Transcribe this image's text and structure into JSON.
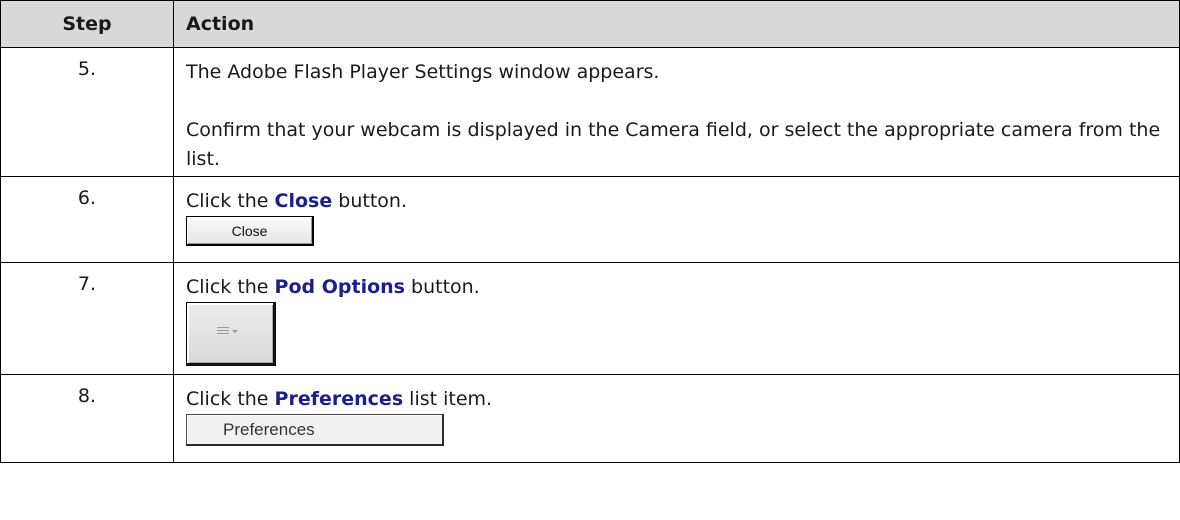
{
  "table": {
    "headers": {
      "step": "Step",
      "action": "Action"
    },
    "rows": [
      {
        "step": "5.",
        "line1": "The Adobe Flash Player Settings window appears.",
        "line2": "Confirm that your webcam is displayed in the Camera field, or select the appropriate camera from the list."
      },
      {
        "step": "6.",
        "before": "Click the ",
        "bold": "Close",
        "after": " button.",
        "control_label": "Close"
      },
      {
        "step": "7.",
        "before": "Click the ",
        "bold": "Pod Options",
        "after": " button.",
        "control_icon": "menu-lines-dropdown-icon"
      },
      {
        "step": "8.",
        "before": "Click the ",
        "bold": "Preferences",
        "after": " list item.",
        "control_label": "Preferences"
      }
    ]
  },
  "colors": {
    "header_bg": "#d9d9d9",
    "highlight_text": "#1b1f8a",
    "border": "#000000"
  }
}
